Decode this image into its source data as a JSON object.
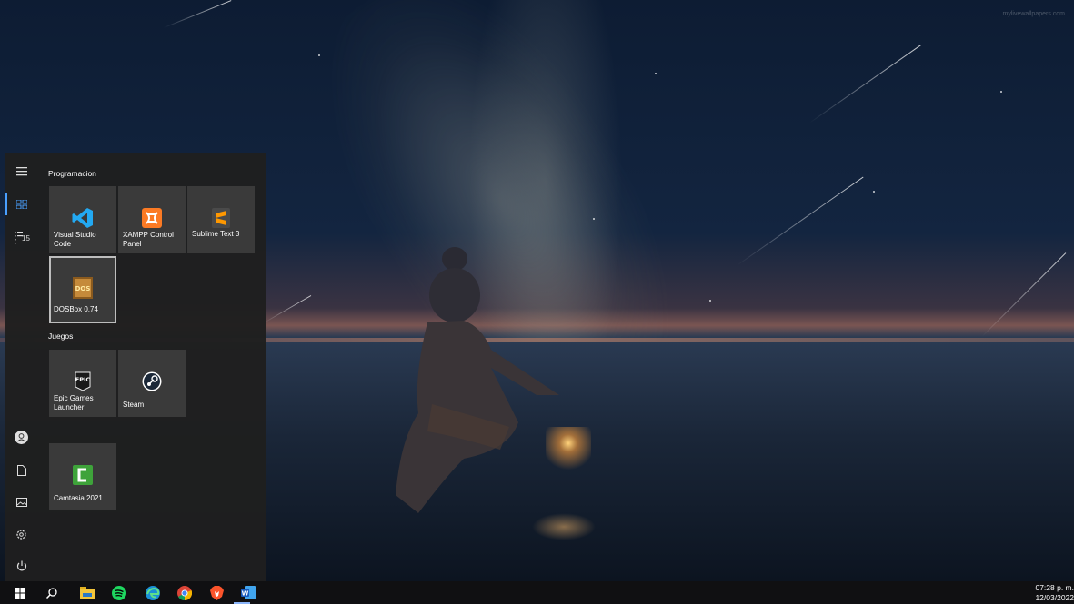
{
  "wallpaper": {
    "watermark": "mylivewallpapers.com"
  },
  "start_menu": {
    "rail": {
      "items": [
        {
          "icon": "hamburger-icon"
        },
        {
          "icon": "tiles-icon",
          "active": true
        },
        {
          "icon": "all-apps-icon",
          "badge": "15"
        },
        {
          "icon": "user-icon"
        },
        {
          "icon": "documents-icon"
        },
        {
          "icon": "pictures-icon"
        },
        {
          "icon": "settings-icon"
        },
        {
          "icon": "power-icon"
        }
      ]
    },
    "groups": [
      {
        "title": "Programacion",
        "tiles": [
          {
            "label": "Visual Studio Code",
            "icon": "vscode-icon",
            "color": "#23a9f2"
          },
          {
            "label": "XAMPP Control Panel",
            "icon": "xampp-icon",
            "color": "#fb7a24"
          },
          {
            "label": "Sublime Text 3",
            "icon": "sublime-icon",
            "color": "#ff9800"
          },
          {
            "label": "DOSBox 0.74",
            "icon": "dosbox-icon",
            "color": "#c58a3a",
            "selected": true
          }
        ]
      },
      {
        "title": "Juegos",
        "tiles": [
          {
            "label": "Epic Games Launcher",
            "icon": "epic-games-icon",
            "color": "#2a2a2a"
          },
          {
            "label": "Steam",
            "icon": "steam-icon",
            "color": "#1b2838"
          }
        ]
      },
      {
        "title": "",
        "tiles": [
          {
            "label": "Camtasia 2021",
            "icon": "camtasia-icon",
            "color": "#3ea33a"
          }
        ]
      }
    ]
  },
  "taskbar": {
    "items": [
      {
        "icon": "windows-start-icon"
      },
      {
        "icon": "search-icon"
      },
      {
        "icon": "file-explorer-icon"
      },
      {
        "icon": "spotify-icon"
      },
      {
        "icon": "edge-icon"
      },
      {
        "icon": "chrome-icon"
      },
      {
        "icon": "brave-icon"
      },
      {
        "icon": "word-icon"
      }
    ],
    "clock": {
      "time": "07:28 p. m.",
      "date": "12/03/2022"
    }
  }
}
